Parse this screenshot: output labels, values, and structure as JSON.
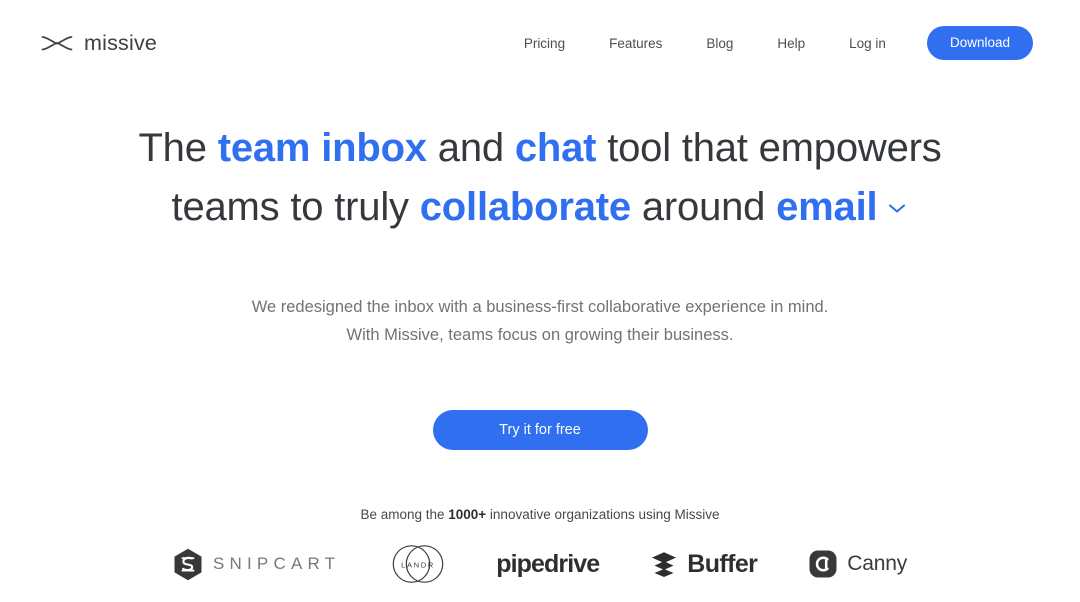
{
  "brand": {
    "name": "missive",
    "mark_icon": "missive-butterfly-icon"
  },
  "header": {
    "nav_links": [
      {
        "label": "Pricing"
      },
      {
        "label": "Features"
      },
      {
        "label": "Blog"
      },
      {
        "label": "Help"
      },
      {
        "label": "Log in"
      }
    ],
    "download_label": "Download"
  },
  "hero": {
    "headline": {
      "line1": [
        {
          "text": "The ",
          "style": "plain"
        },
        {
          "text": "team inbox",
          "style": "accent"
        },
        {
          "text": " and ",
          "style": "plain"
        },
        {
          "text": "chat",
          "style": "accent"
        },
        {
          "text": " tool that empowers",
          "style": "plain"
        }
      ],
      "line2": [
        {
          "text": "teams to truly ",
          "style": "plain"
        },
        {
          "text": "collaborate",
          "style": "accent"
        },
        {
          "text": " around ",
          "style": "plain"
        },
        {
          "text": "email",
          "style": "accent"
        }
      ],
      "dropdown_icon": "chevron-down-icon",
      "part_the": "The ",
      "part_team_inbox": "team inbox",
      "part_and": " and ",
      "part_chat": "chat",
      "part_tool": " tool that empowers",
      "part_teams": "teams to truly ",
      "part_collaborate": "collaborate",
      "part_around": " around ",
      "part_email": "email"
    },
    "subhead_line1": "We redesigned the inbox with a business-first collaborative experience in mind.",
    "subhead_line2": "With Missive, teams focus on growing their business.",
    "cta_label": "Try it for free"
  },
  "social_proof": {
    "prefix": "Be among the ",
    "count": "1000+",
    "suffix": " innovative organizations using Missive",
    "logos": [
      {
        "name": "Snipcart",
        "wordmark": "SNIPCART",
        "icon": "snipcart-hexagon-icon"
      },
      {
        "name": "LANDR",
        "wordmark": "LANDR",
        "icon": "landr-circles-icon"
      },
      {
        "name": "Pipedrive",
        "wordmark": "pipedrive",
        "icon": "none"
      },
      {
        "name": "Buffer",
        "wordmark": "Buffer",
        "icon": "buffer-layers-icon"
      },
      {
        "name": "Canny",
        "wordmark": "Canny",
        "icon": "canny-badge-icon"
      }
    ]
  },
  "colors": {
    "accent_blue": "#2f6ff0",
    "text_dark": "#35383c",
    "text_muted": "#6f7378",
    "background": "#ffffff",
    "logo_dark": "#1d1f21"
  }
}
